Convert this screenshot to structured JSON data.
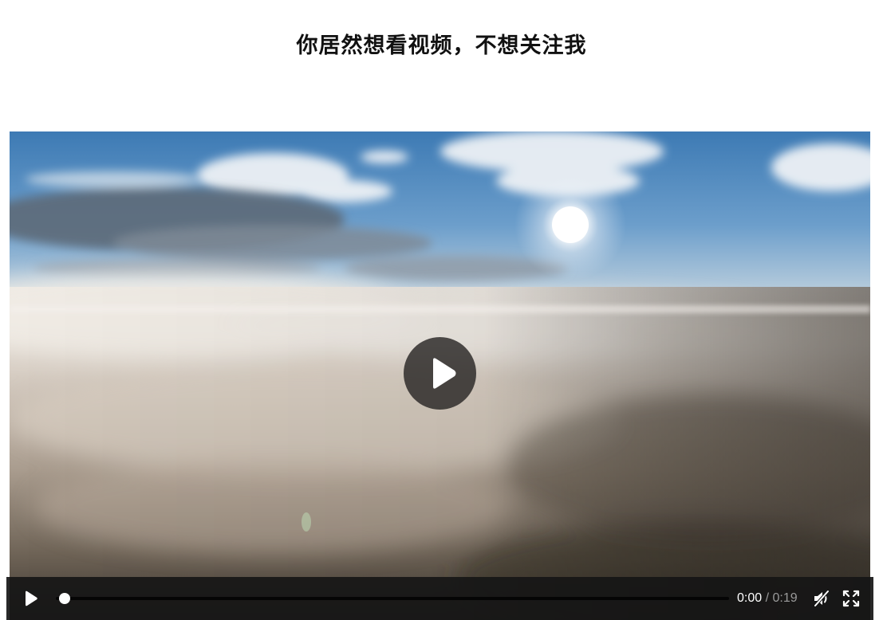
{
  "page": {
    "title": "你居然想看视频，不想关注我"
  },
  "video": {
    "big_play_icon": "play-icon",
    "controls": {
      "play_icon": "play-icon",
      "progress": 0,
      "current_time": "0:00",
      "separator": "/",
      "duration": "0:19",
      "volume_icon": "muted-speaker-icon",
      "fullscreen_icon": "fullscreen-icon"
    }
  },
  "colors": {
    "title": "#111111",
    "control_bar": "#161616",
    "big_play_bg": "#282624",
    "sky": "#3f7fb8",
    "clouds": "#e9e3dc"
  }
}
